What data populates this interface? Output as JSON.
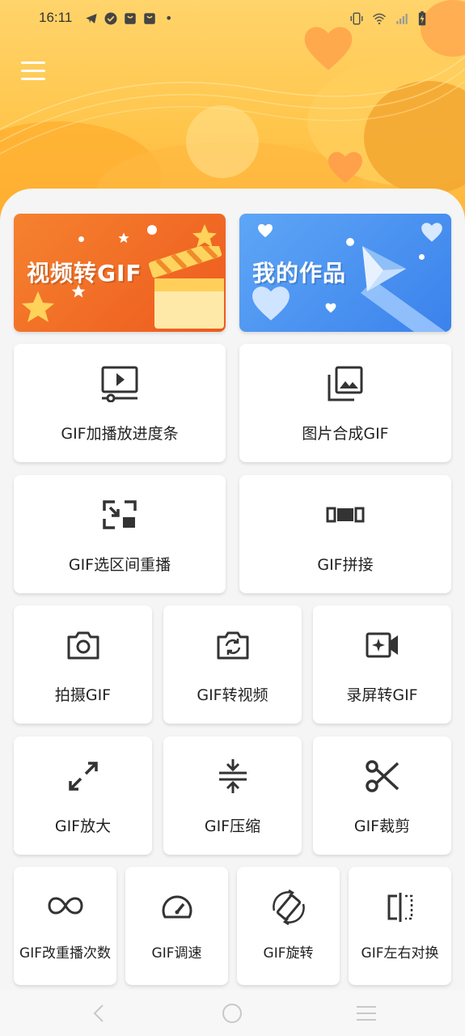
{
  "status_bar": {
    "time": "16:11",
    "dot": "•"
  },
  "header": {
    "menu_icon": "hamburger-menu-icon"
  },
  "banners": [
    {
      "label": "视频转GIF",
      "color": "#f26a1f"
    },
    {
      "label": "我的作品",
      "color": "#3d8ef0"
    }
  ],
  "tools_row1": [
    {
      "label": "GIF加播放进度条",
      "icon": "video-progress-icon"
    },
    {
      "label": "图片合成GIF",
      "icon": "image-stack-icon"
    }
  ],
  "tools_row2": [
    {
      "label": "GIF选区间重播",
      "icon": "select-range-icon"
    },
    {
      "label": "GIF拼接",
      "icon": "splice-icon"
    }
  ],
  "tools_row3": [
    {
      "label": "拍摄GIF",
      "icon": "camera-icon"
    },
    {
      "label": "GIF转视频",
      "icon": "camera-switch-icon"
    },
    {
      "label": "录屏转GIF",
      "icon": "screen-record-icon"
    }
  ],
  "tools_row4": [
    {
      "label": "GIF放大",
      "icon": "expand-icon"
    },
    {
      "label": "GIF压缩",
      "icon": "compress-icon"
    },
    {
      "label": "GIF裁剪",
      "icon": "scissors-icon"
    }
  ],
  "tools_row5": [
    {
      "label": "GIF改重播次数",
      "icon": "infinity-icon"
    },
    {
      "label": "GIF调速",
      "icon": "speedometer-icon"
    },
    {
      "label": "GIF旋转",
      "icon": "rotate-icon"
    },
    {
      "label": "GIF左右对换",
      "icon": "flip-horizontal-icon"
    }
  ]
}
